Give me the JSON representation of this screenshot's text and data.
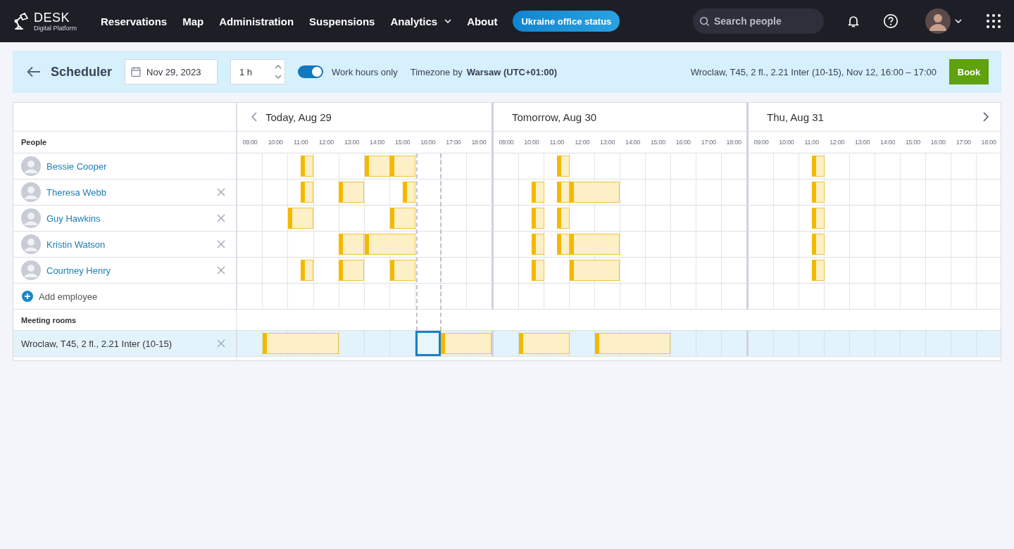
{
  "brand": {
    "name": "DESK",
    "subtitle": "Digital Platform"
  },
  "nav": [
    {
      "label": "Reservations",
      "dropdown": false
    },
    {
      "label": "Map",
      "dropdown": false
    },
    {
      "label": "Administration",
      "dropdown": false
    },
    {
      "label": "Suspensions",
      "dropdown": false
    },
    {
      "label": "Analytics",
      "dropdown": true
    },
    {
      "label": "About",
      "dropdown": false
    }
  ],
  "status_button": "Ukraine office status",
  "search": {
    "placeholder": "Search people"
  },
  "toolbar": {
    "title": "Scheduler",
    "date": "Nov 29, 2023",
    "duration": "1 h",
    "work_hours_only": {
      "label": "Work hours only",
      "on": true
    },
    "timezone_label": "Timezone by",
    "timezone": "Warsaw (UTC+01:00)",
    "summary": "Wroclaw, T45, 2 fl., 2.21 Inter (10-15), Nov 12, 16:00 – 17:00",
    "book_button": "Book"
  },
  "days": [
    {
      "title": "Today, Aug 29",
      "hours": [
        "09:00",
        "10:00",
        "11:00",
        "12:00",
        "13:00",
        "14:00",
        "15:00",
        "16:00",
        "17:00",
        "18:00"
      ]
    },
    {
      "title": "Tomorrow, Aug 30",
      "hours": [
        "09:00",
        "10:00",
        "11:00",
        "12:00",
        "13:00",
        "14:00",
        "15:00",
        "16:00",
        "17:00",
        "18:00"
      ]
    },
    {
      "title": "Thu, Aug 31",
      "hours": [
        "09:00",
        "10:00",
        "11:00",
        "12:00",
        "13:00",
        "14:00",
        "15:00",
        "16:00",
        "17:00",
        "18:00"
      ]
    }
  ],
  "people_heading": "People",
  "people": [
    {
      "name": "Bessie Cooper",
      "removable": false,
      "days": [
        [
          {
            "kind": "free"
          },
          {
            "kind": "free"
          },
          {
            "kind": "half"
          },
          {
            "kind": "free"
          },
          {
            "kind": "free"
          },
          {
            "kind": "start"
          },
          {
            "kind": "start"
          },
          {
            "kind": "free"
          },
          {
            "kind": "free"
          },
          {
            "kind": "free"
          }
        ],
        [
          {
            "kind": "free"
          },
          {
            "kind": "free"
          },
          {
            "kind": "half"
          },
          {
            "kind": "free"
          },
          {
            "kind": "free"
          },
          {
            "kind": "free"
          },
          {
            "kind": "free"
          },
          {
            "kind": "free"
          },
          {
            "kind": "free"
          },
          {
            "kind": "free"
          }
        ],
        [
          {
            "kind": "free"
          },
          {
            "kind": "free"
          },
          {
            "kind": "half"
          },
          {
            "kind": "free"
          },
          {
            "kind": "free"
          },
          {
            "kind": "free"
          },
          {
            "kind": "free"
          },
          {
            "kind": "free"
          },
          {
            "kind": "free"
          },
          {
            "kind": "free"
          }
        ]
      ]
    },
    {
      "name": "Theresa Webb",
      "removable": true,
      "days": [
        [
          {
            "kind": "free"
          },
          {
            "kind": "free"
          },
          {
            "kind": "half"
          },
          {
            "kind": "free"
          },
          {
            "kind": "start"
          },
          {
            "kind": "free"
          },
          {
            "kind": "half"
          },
          {
            "kind": "free"
          },
          {
            "kind": "free"
          },
          {
            "kind": "free"
          }
        ],
        [
          {
            "kind": "free"
          },
          {
            "kind": "half"
          },
          {
            "kind": "half"
          },
          {
            "kind": "start"
          },
          {
            "kind": "cont"
          },
          {
            "kind": "free"
          },
          {
            "kind": "free"
          },
          {
            "kind": "free"
          },
          {
            "kind": "free"
          },
          {
            "kind": "free"
          }
        ],
        [
          {
            "kind": "free"
          },
          {
            "kind": "free"
          },
          {
            "kind": "half"
          },
          {
            "kind": "free"
          },
          {
            "kind": "free"
          },
          {
            "kind": "free"
          },
          {
            "kind": "free"
          },
          {
            "kind": "free"
          },
          {
            "kind": "free"
          },
          {
            "kind": "free"
          }
        ]
      ]
    },
    {
      "name": "Guy Hawkins",
      "removable": true,
      "days": [
        [
          {
            "kind": "free"
          },
          {
            "kind": "free"
          },
          {
            "kind": "start"
          },
          {
            "kind": "free"
          },
          {
            "kind": "free"
          },
          {
            "kind": "free"
          },
          {
            "kind": "start"
          },
          {
            "kind": "free"
          },
          {
            "kind": "free"
          },
          {
            "kind": "free"
          }
        ],
        [
          {
            "kind": "free"
          },
          {
            "kind": "half"
          },
          {
            "kind": "half"
          },
          {
            "kind": "free"
          },
          {
            "kind": "free"
          },
          {
            "kind": "free"
          },
          {
            "kind": "free"
          },
          {
            "kind": "free"
          },
          {
            "kind": "free"
          },
          {
            "kind": "free"
          }
        ],
        [
          {
            "kind": "free"
          },
          {
            "kind": "free"
          },
          {
            "kind": "half"
          },
          {
            "kind": "free"
          },
          {
            "kind": "free"
          },
          {
            "kind": "free"
          },
          {
            "kind": "free"
          },
          {
            "kind": "free"
          },
          {
            "kind": "free"
          },
          {
            "kind": "free"
          }
        ]
      ]
    },
    {
      "name": "Kristin Watson",
      "removable": true,
      "days": [
        [
          {
            "kind": "free"
          },
          {
            "kind": "free"
          },
          {
            "kind": "free"
          },
          {
            "kind": "free"
          },
          {
            "kind": "start"
          },
          {
            "kind": "start"
          },
          {
            "kind": "cont"
          },
          {
            "kind": "free"
          },
          {
            "kind": "free"
          },
          {
            "kind": "free"
          }
        ],
        [
          {
            "kind": "free"
          },
          {
            "kind": "half"
          },
          {
            "kind": "half"
          },
          {
            "kind": "start"
          },
          {
            "kind": "cont"
          },
          {
            "kind": "free"
          },
          {
            "kind": "free"
          },
          {
            "kind": "free"
          },
          {
            "kind": "free"
          },
          {
            "kind": "free"
          }
        ],
        [
          {
            "kind": "free"
          },
          {
            "kind": "free"
          },
          {
            "kind": "half"
          },
          {
            "kind": "free"
          },
          {
            "kind": "free"
          },
          {
            "kind": "free"
          },
          {
            "kind": "free"
          },
          {
            "kind": "free"
          },
          {
            "kind": "free"
          },
          {
            "kind": "free"
          }
        ]
      ]
    },
    {
      "name": "Courtney Henry",
      "removable": true,
      "days": [
        [
          {
            "kind": "free"
          },
          {
            "kind": "free"
          },
          {
            "kind": "half"
          },
          {
            "kind": "free"
          },
          {
            "kind": "start"
          },
          {
            "kind": "free"
          },
          {
            "kind": "start"
          },
          {
            "kind": "free"
          },
          {
            "kind": "free"
          },
          {
            "kind": "free"
          }
        ],
        [
          {
            "kind": "free"
          },
          {
            "kind": "half"
          },
          {
            "kind": "free"
          },
          {
            "kind": "start"
          },
          {
            "kind": "cont"
          },
          {
            "kind": "free"
          },
          {
            "kind": "free"
          },
          {
            "kind": "free"
          },
          {
            "kind": "free"
          },
          {
            "kind": "free"
          }
        ],
        [
          {
            "kind": "free"
          },
          {
            "kind": "free"
          },
          {
            "kind": "half"
          },
          {
            "kind": "free"
          },
          {
            "kind": "free"
          },
          {
            "kind": "free"
          },
          {
            "kind": "free"
          },
          {
            "kind": "free"
          },
          {
            "kind": "free"
          },
          {
            "kind": "free"
          }
        ]
      ]
    }
  ],
  "add_employee": "Add employee",
  "rooms_heading": "Meeting rooms",
  "rooms": [
    {
      "name": "Wroclaw, T45, 2 fl., 2.21 Inter (10-15)",
      "removable": true,
      "days": [
        [
          {
            "kind": "free"
          },
          {
            "kind": "start"
          },
          {
            "kind": "cont"
          },
          {
            "kind": "cont"
          },
          {
            "kind": "free"
          },
          {
            "kind": "free"
          },
          {
            "kind": "free"
          },
          {
            "kind": "selected"
          },
          {
            "kind": "start"
          },
          {
            "kind": "cont"
          }
        ],
        [
          {
            "kind": "free"
          },
          {
            "kind": "start"
          },
          {
            "kind": "cont"
          },
          {
            "kind": "free"
          },
          {
            "kind": "start"
          },
          {
            "kind": "cont"
          },
          {
            "kind": "cont"
          },
          {
            "kind": "free"
          },
          {
            "kind": "free"
          },
          {
            "kind": "free"
          }
        ],
        [
          {
            "kind": "free"
          },
          {
            "kind": "free"
          },
          {
            "kind": "free"
          },
          {
            "kind": "free"
          },
          {
            "kind": "free"
          },
          {
            "kind": "free"
          },
          {
            "kind": "free"
          },
          {
            "kind": "free"
          },
          {
            "kind": "free"
          },
          {
            "kind": "free"
          }
        ]
      ]
    }
  ]
}
